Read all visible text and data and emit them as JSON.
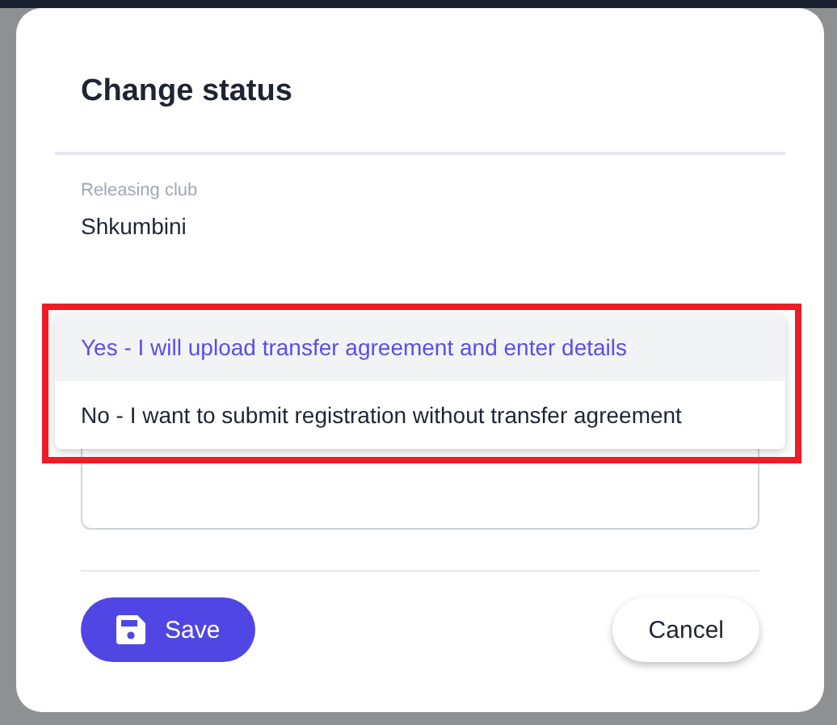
{
  "dialog": {
    "title": "Change status"
  },
  "releasing_club": {
    "label": "Releasing club",
    "value": "Shkumbini"
  },
  "dropdown": {
    "highlighted": true,
    "options": [
      {
        "label": "Yes - I will upload transfer agreement and enter details",
        "selected": true
      },
      {
        "label": "No - I want to submit registration without transfer agreement",
        "selected": false
      }
    ]
  },
  "buttons": [
    {
      "kind": "primary",
      "label": "Save"
    },
    {
      "kind": "secondary",
      "label": "Cancel"
    }
  ]
}
